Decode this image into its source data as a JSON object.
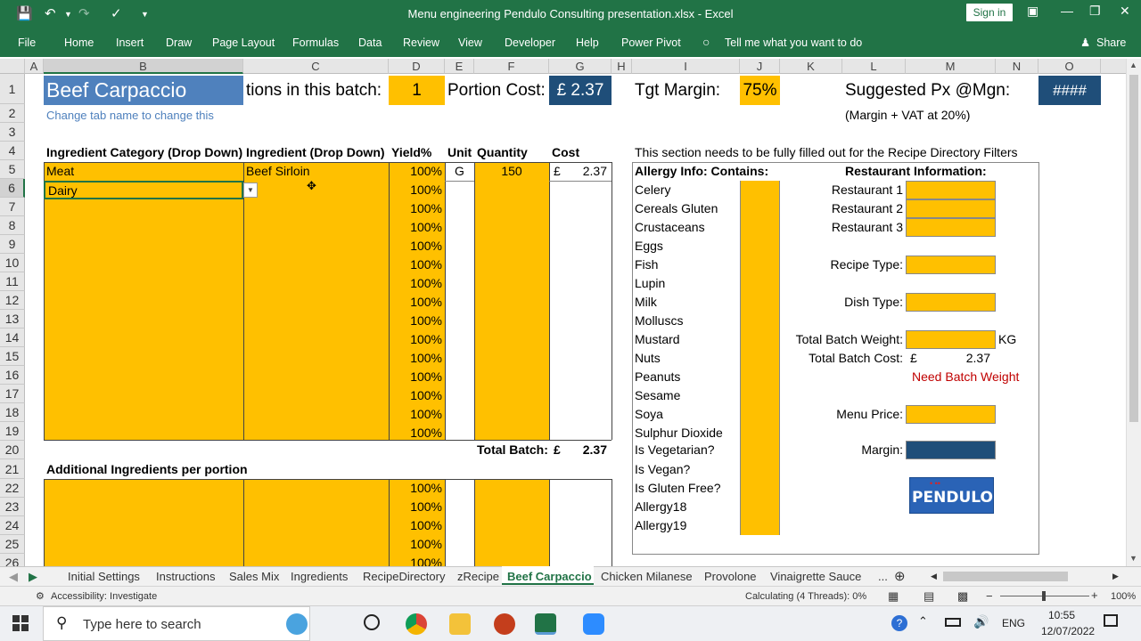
{
  "window": {
    "title": "Menu engineering Pendulo Consulting presentation.xlsx  -  Excel",
    "signin": "Sign in"
  },
  "ribbon": {
    "tabs": [
      "File",
      "Home",
      "Insert",
      "Draw",
      "Page Layout",
      "Formulas",
      "Data",
      "Review",
      "View",
      "Developer",
      "Help",
      "Power Pivot"
    ],
    "tell_me": "Tell me what you want to do",
    "share": "Share"
  },
  "columns": [
    "A",
    "B",
    "C",
    "D",
    "E",
    "F",
    "G",
    "H",
    "I",
    "J",
    "K",
    "L",
    "M",
    "N",
    "O"
  ],
  "rows": [
    "1",
    "2",
    "3",
    "4",
    "5",
    "6",
    "7",
    "8",
    "9",
    "10",
    "11",
    "12",
    "13",
    "14",
    "15",
    "16",
    "17",
    "18",
    "19",
    "20",
    "21",
    "22",
    "23",
    "24",
    "25",
    "26"
  ],
  "recipe": {
    "name": "Beef Carpaccio",
    "portions_label": "tions in this batch:",
    "portions": "1",
    "portion_cost_label": "Portion Cost:",
    "portion_cost": "£ 2.37",
    "tgt_margin_label": "Tgt Margin:",
    "tgt_margin": "75%",
    "suggested_label": "Suggested Px @Mgn:",
    "suggested_value": "####",
    "hint": "Change tab name to change this",
    "vat_note": "(Margin + VAT at 20%)"
  },
  "headers": {
    "category": "Ingredient Category (Drop Down)",
    "ingredient": "Ingredient (Drop Down)",
    "yield": "Yield%",
    "unit": "Unit",
    "quantity": "Quantity",
    "cost": "Cost",
    "section_note": "This section needs to be fully filled out for the Recipe Directory Filters"
  },
  "ingredients": [
    {
      "category": "Meat",
      "ingredient": "Beef Sirloin",
      "unit": "G",
      "quantity": "150",
      "cost_sym": "£",
      "cost": "2.37"
    },
    {
      "category": "Dairy",
      "ingredient": ""
    }
  ],
  "yield_default": "100%",
  "totals": {
    "label": "Total Batch:",
    "sym": "£",
    "value": "2.37"
  },
  "additional_label": "Additional Ingredients per portion",
  "allergy": {
    "title": "Allergy Info: Contains:",
    "items": [
      "Celery",
      "Cereals Gluten",
      "Crustaceans",
      "Eggs",
      "Fish",
      "Lupin",
      "Milk",
      "Molluscs",
      "Mustard",
      "Nuts",
      "Peanuts",
      "Sesame",
      "Soya",
      "Sulphur Dioxide",
      "Is Vegetarian?",
      "Is Vegan?",
      "Is Gluten Free?",
      "Allergy18",
      "Allergy19"
    ]
  },
  "restaurant": {
    "title": "Restaurant Information:",
    "r1": "Restaurant 1",
    "r2": "Restaurant 2",
    "r3": "Restaurant 3",
    "recipe_type": "Recipe Type:",
    "dish_type": "Dish Type:",
    "batch_weight": "Total Batch Weight:",
    "kg": "KG",
    "batch_cost": "Total Batch Cost:",
    "batch_cost_sym": "£",
    "batch_cost_value": "2.37",
    "warning": "Need Batch Weight",
    "menu_price": "Menu Price:",
    "margin": "Margin:",
    "logo": "PENDULO"
  },
  "sheets": [
    "Initial Settings",
    "Instructions",
    "Sales Mix",
    "Ingredients",
    "RecipeDirectory",
    "zRecipe",
    "Beef Carpaccio",
    "Chicken Milanese",
    "Provolone",
    "Vinaigrette Sauce",
    "..."
  ],
  "active_sheet": "Beef Carpaccio",
  "status": {
    "accessibility": "Accessibility: Investigate",
    "calculating": "Calculating (4 Threads): 0%",
    "zoom": "100%"
  },
  "taskbar": {
    "search_placeholder": "Type here to search",
    "lang": "ENG",
    "time": "10:55",
    "date": "12/07/2022"
  },
  "colors": {
    "excel_green": "#217346",
    "orange": "#ffc000",
    "blue": "#1f4e79",
    "title_blue": "#4f81bd",
    "warning_red": "#c00000"
  }
}
